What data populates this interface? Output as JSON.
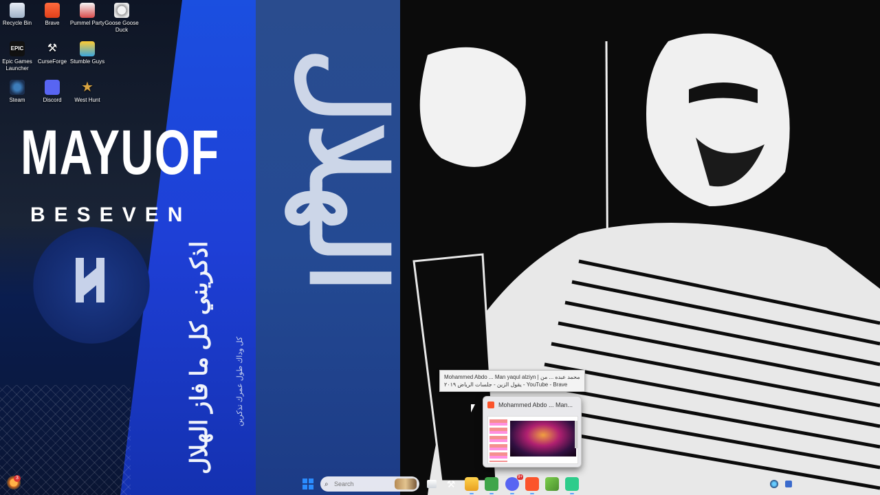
{
  "desktop": {
    "icons": [
      {
        "label": "Recycle Bin",
        "icon": "recycle-bin-icon"
      },
      {
        "label": "Brave",
        "icon": "brave-icon"
      },
      {
        "label": "Pummel Party",
        "icon": "pummel-party-icon"
      },
      {
        "label": "Goose Goose Duck",
        "icon": "goose-goose-duck-icon"
      },
      {
        "label": "Epic Games Launcher",
        "icon": "epic-games-icon"
      },
      {
        "label": "CurseForge",
        "icon": "curseforge-icon"
      },
      {
        "label": "Stumble Guys",
        "icon": "stumble-guys-icon"
      },
      {
        "label": "Steam",
        "icon": "steam-icon"
      },
      {
        "label": "Discord",
        "icon": "discord-icon"
      },
      {
        "label": "West Hunt",
        "icon": "west-hunt-icon"
      }
    ]
  },
  "wallpaper": {
    "name": "MAYUOF",
    "subtitle": "BESEVEN",
    "club_text": "الهلال",
    "verse": "اذكريني كل ما فاز الهلال",
    "verse_sub": "كل وداك طول عمرك تذكرين",
    "colors": {
      "blue": "#1b4fe0",
      "dark": "#0b0b0b"
    }
  },
  "tooltip": {
    "line1": "Mohammed Abdo ... Man yaqul alziyn | محمد عبده ... من",
    "line2": "يقول الزين - جلسات الرياض ٢٠١٩ - YouTube - Brave"
  },
  "preview": {
    "title": "Mohammed Abdo ... Man..."
  },
  "taskbar": {
    "weather_badge": "3",
    "search_placeholder": "Search",
    "apps": [
      "task-view",
      "curseforge",
      "file-explorer",
      "minecraft",
      "discord",
      "brave",
      "minecraft-launcher",
      "app"
    ],
    "discord_badge": "9+"
  }
}
